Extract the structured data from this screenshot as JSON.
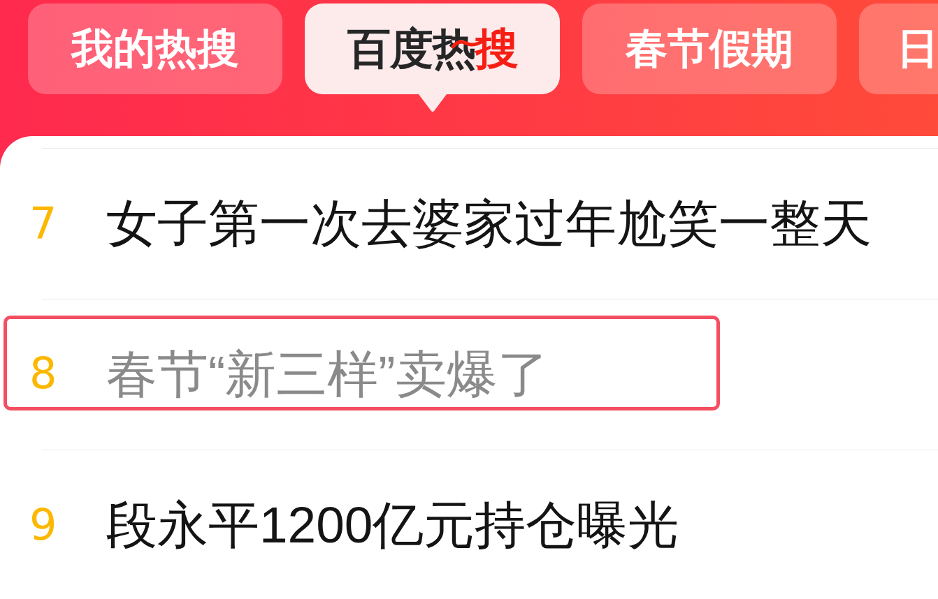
{
  "tabs": [
    {
      "label": "我的热搜",
      "selected": false
    },
    {
      "label": "百度热搜",
      "selected": true
    },
    {
      "label": "春节假期",
      "selected": false
    },
    {
      "label": "日",
      "selected": false
    }
  ],
  "items": [
    {
      "rank": "7",
      "title": "女子第一次去婆家过年尬笑一整天",
      "visited": false,
      "highlighted": false
    },
    {
      "rank": "8",
      "title": "春节“新三样”卖爆了",
      "visited": true,
      "highlighted": true
    },
    {
      "rank": "9",
      "title": "段永平1200亿元持仓曝光",
      "visited": false,
      "highlighted": false
    }
  ]
}
